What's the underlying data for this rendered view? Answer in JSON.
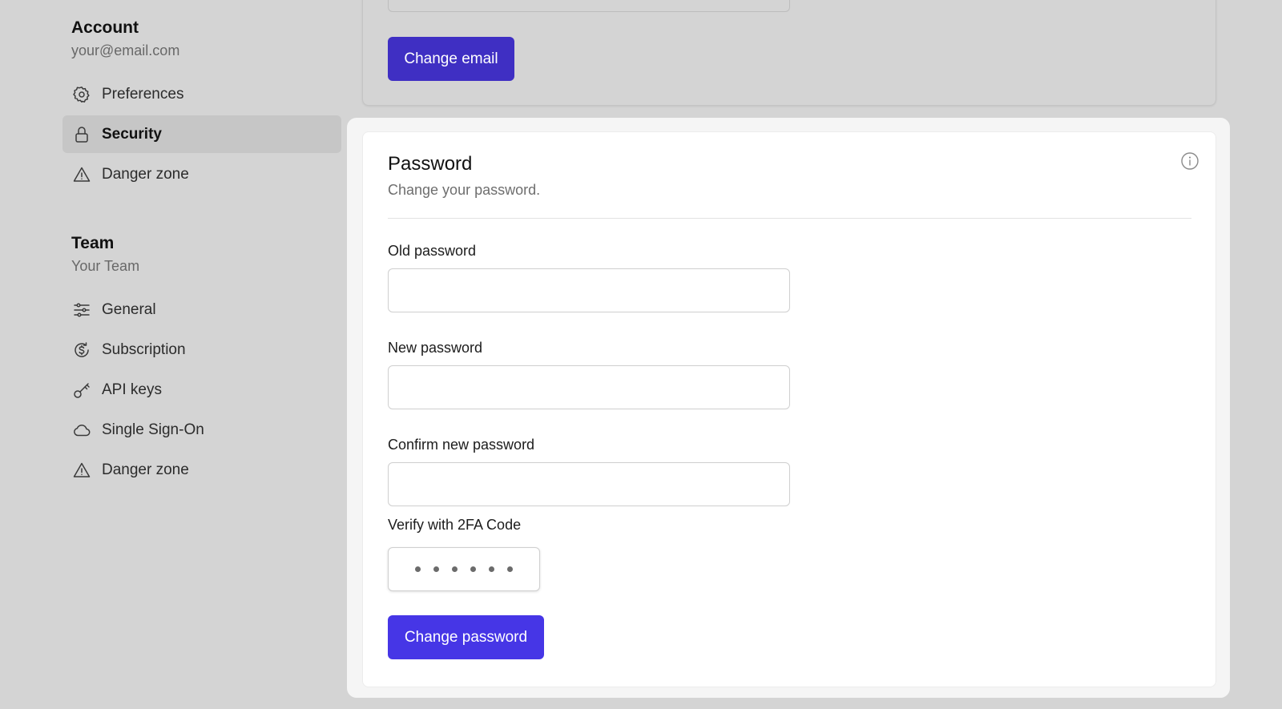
{
  "account": {
    "title": "Account",
    "email": "your@email.com",
    "items": [
      {
        "label": "Preferences",
        "icon": "gear-icon"
      },
      {
        "label": "Security",
        "icon": "lock-icon",
        "active": true
      },
      {
        "label": "Danger zone",
        "icon": "warning-icon"
      }
    ]
  },
  "team": {
    "title": "Team",
    "name": "Your Team",
    "items": [
      {
        "label": "General",
        "icon": "sliders-icon"
      },
      {
        "label": "Subscription",
        "icon": "dollar-cycle-icon"
      },
      {
        "label": "API keys",
        "icon": "key-icon"
      },
      {
        "label": "Single Sign-On",
        "icon": "cloud-icon"
      },
      {
        "label": "Danger zone",
        "icon": "warning-icon"
      }
    ]
  },
  "email_card": {
    "button_label": "Change email"
  },
  "password_card": {
    "title": "Password",
    "description": "Change your password.",
    "old_password_label": "Old password",
    "new_password_label": "New password",
    "confirm_password_label": "Confirm new password",
    "twofa_label": "Verify with 2FA Code",
    "twofa_digits": 6,
    "button_label": "Change password"
  },
  "colors": {
    "primary_button": "#4636e6",
    "dimmed_button": "#3f2fc3",
    "background": "#d4d4d4"
  }
}
